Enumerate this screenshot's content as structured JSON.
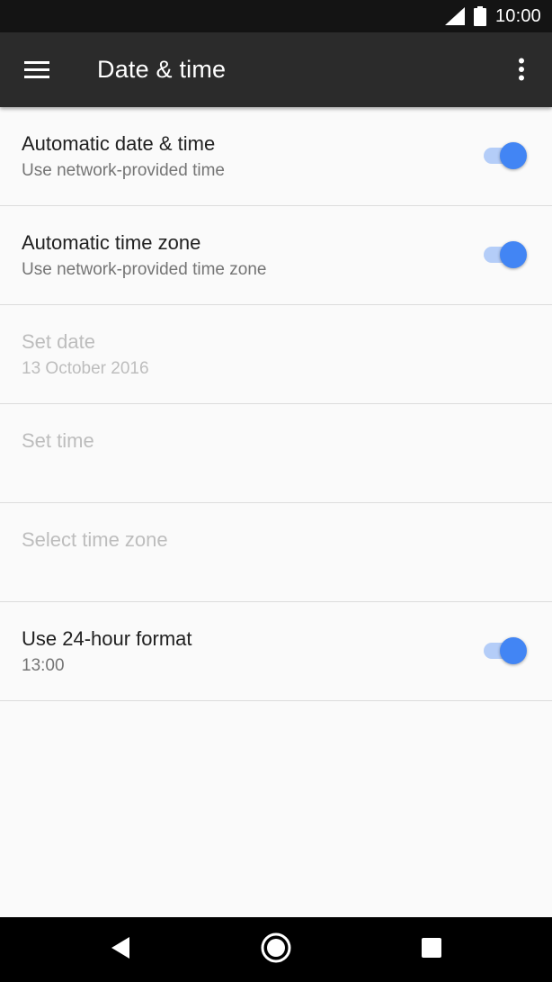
{
  "status_bar": {
    "time": "10:00",
    "icons": [
      "cellular-signal-icon",
      "battery-icon"
    ]
  },
  "app_bar": {
    "title": "Date & time",
    "icons": [
      "menu-icon",
      "more-vert-icon"
    ]
  },
  "settings": [
    {
      "title": "Automatic date & time",
      "summary": "Use network-provided time",
      "enabled": true,
      "toggle_on": true
    },
    {
      "title": "Automatic time zone",
      "summary": "Use network-provided time zone",
      "enabled": true,
      "toggle_on": true
    },
    {
      "title": "Set date",
      "summary": "13 October 2016",
      "enabled": false
    },
    {
      "title": "Set time",
      "summary": "",
      "enabled": false
    },
    {
      "title": "Select time zone",
      "summary": "",
      "enabled": false
    },
    {
      "title": "Use 24-hour format",
      "summary": "13:00",
      "enabled": true,
      "toggle_on": true
    }
  ],
  "nav_bar": {
    "icons": [
      "back-icon",
      "home-icon",
      "recents-icon"
    ]
  },
  "colors": {
    "status_bar": "#141414",
    "app_bar": "#2b2b2b",
    "background": "#fafafa",
    "accent": "#4285f4",
    "toggle_track": "#b4cdf8",
    "primary_text": "#212121",
    "secondary_text": "#757575",
    "disabled_text": "#bdbdbd",
    "divider": "#dcdcdc",
    "nav_bar": "#000000"
  }
}
